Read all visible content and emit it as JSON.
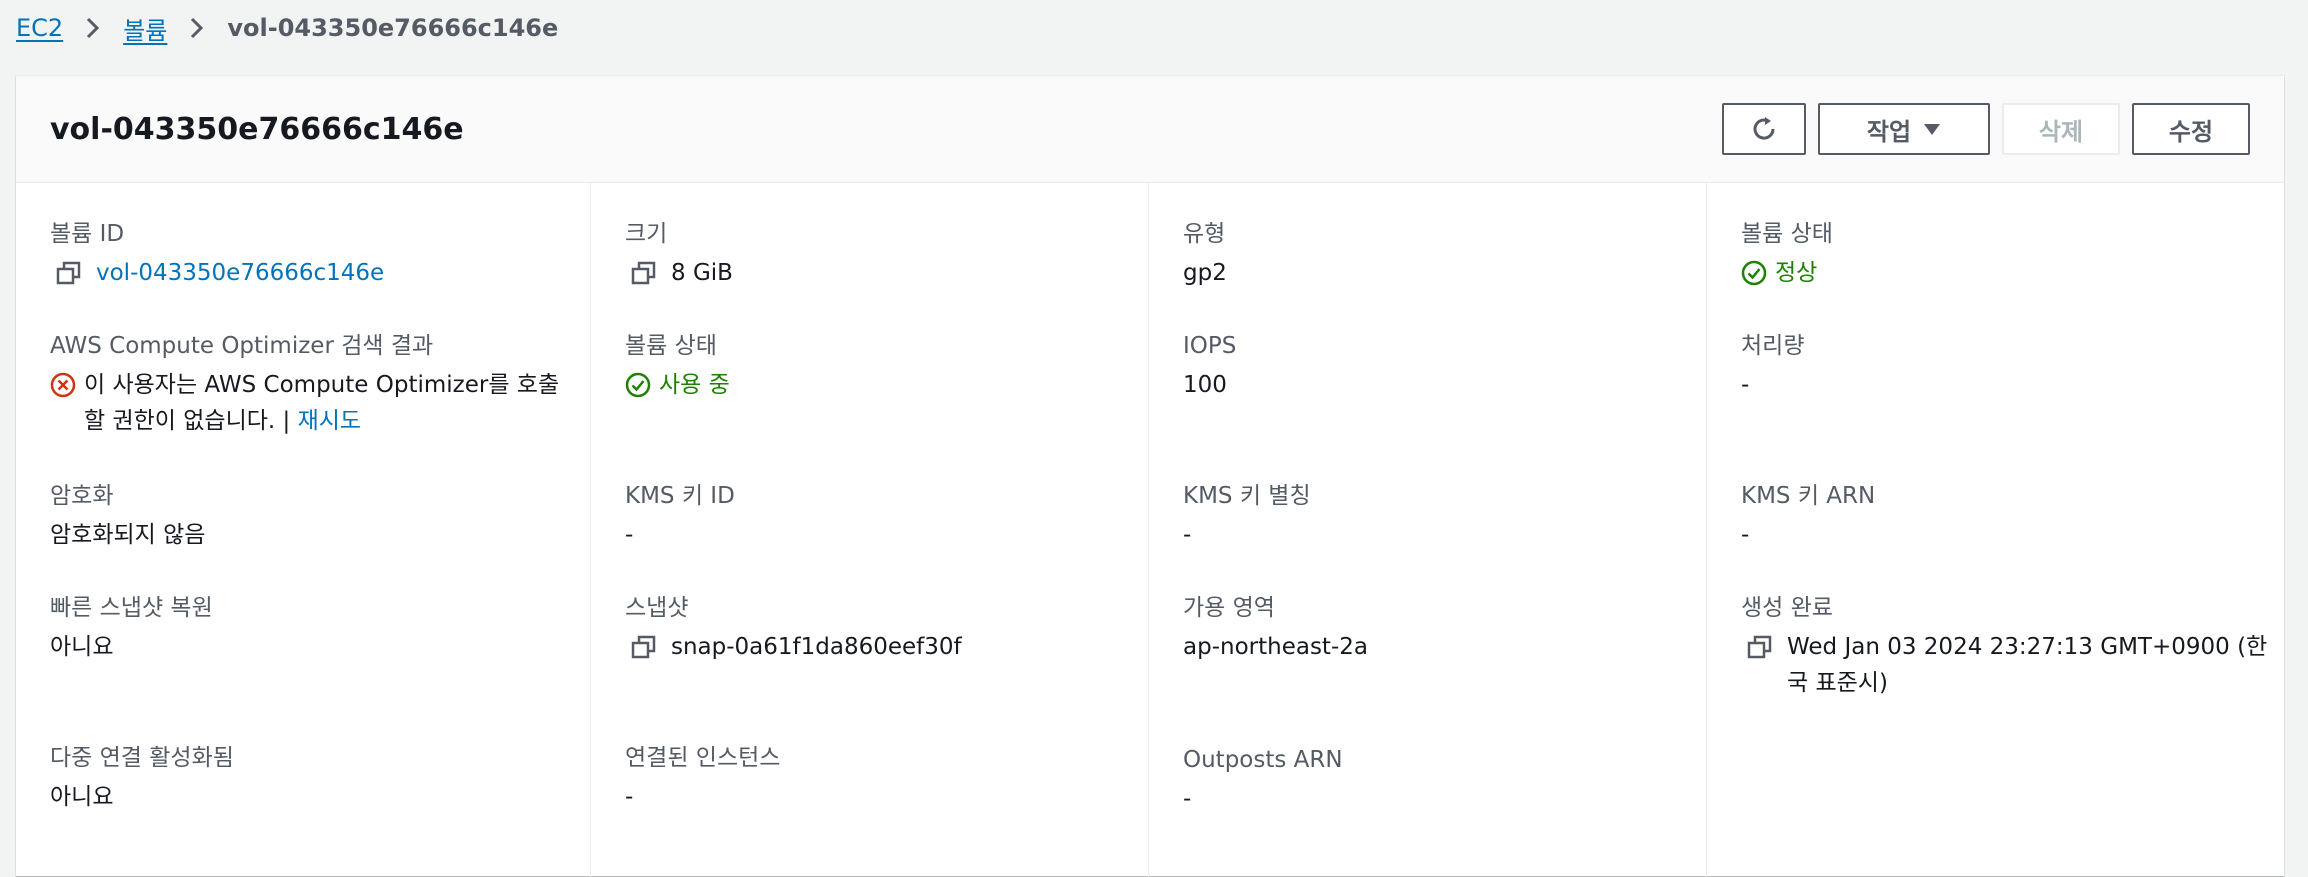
{
  "breadcrumb": {
    "items": [
      "EC2",
      "볼륨"
    ],
    "current": "vol-043350e76666c146e"
  },
  "header": {
    "title": "vol-043350e76666c146e",
    "actions_label": "작업",
    "delete_label": "삭제",
    "edit_label": "수정"
  },
  "fields": {
    "volume_id": {
      "label": "볼륨 ID",
      "value": "vol-043350e76666c146e"
    },
    "size": {
      "label": "크기",
      "value": "8 GiB"
    },
    "type": {
      "label": "유형",
      "value": "gp2"
    },
    "volume_status": {
      "label": "볼륨 상태",
      "value": "정상"
    },
    "optimizer": {
      "label": "AWS Compute Optimizer 검색 결과",
      "message": "이 사용자는 AWS Compute Optimizer를 호출할 권한이 없습니다. |",
      "retry": "재시도"
    },
    "volume_state": {
      "label": "볼륨 상태",
      "value": "사용 중"
    },
    "iops": {
      "label": "IOPS",
      "value": "100"
    },
    "throughput": {
      "label": "처리량",
      "value": "-"
    },
    "encryption": {
      "label": "암호화",
      "value": "암호화되지 않음"
    },
    "kms_key_id": {
      "label": "KMS 키 ID",
      "value": "-"
    },
    "kms_key_alias": {
      "label": "KMS 키 별칭",
      "value": "-"
    },
    "kms_key_arn": {
      "label": "KMS 키 ARN",
      "value": "-"
    },
    "fast_snapshot_restore": {
      "label": "빠른 스냅샷 복원",
      "value": "아니요"
    },
    "snapshot": {
      "label": "스냅샷",
      "value": "snap-0a61f1da860eef30f"
    },
    "availability_zone": {
      "label": "가용 영역",
      "value": "ap-northeast-2a"
    },
    "created": {
      "label": "생성 완료",
      "value": "Wed Jan 03 2024 23:27:13 GMT+0900 (한국 표준시)"
    },
    "multi_attach": {
      "label": "다중 연결 활성화됨",
      "value": "아니요"
    },
    "attached_instances": {
      "label": "연결된 인스턴스",
      "value": "-"
    },
    "outposts_arn": {
      "label": "Outposts ARN",
      "value": "-"
    }
  },
  "colors": {
    "link": "#0073bb",
    "success": "#1d8102",
    "error": "#d13212",
    "text": "#16191f",
    "label": "#545b64"
  },
  "icons": [
    "chevron-right-icon",
    "refresh-icon",
    "caret-down-icon",
    "copy-icon",
    "status-ok-icon",
    "status-error-icon"
  ]
}
